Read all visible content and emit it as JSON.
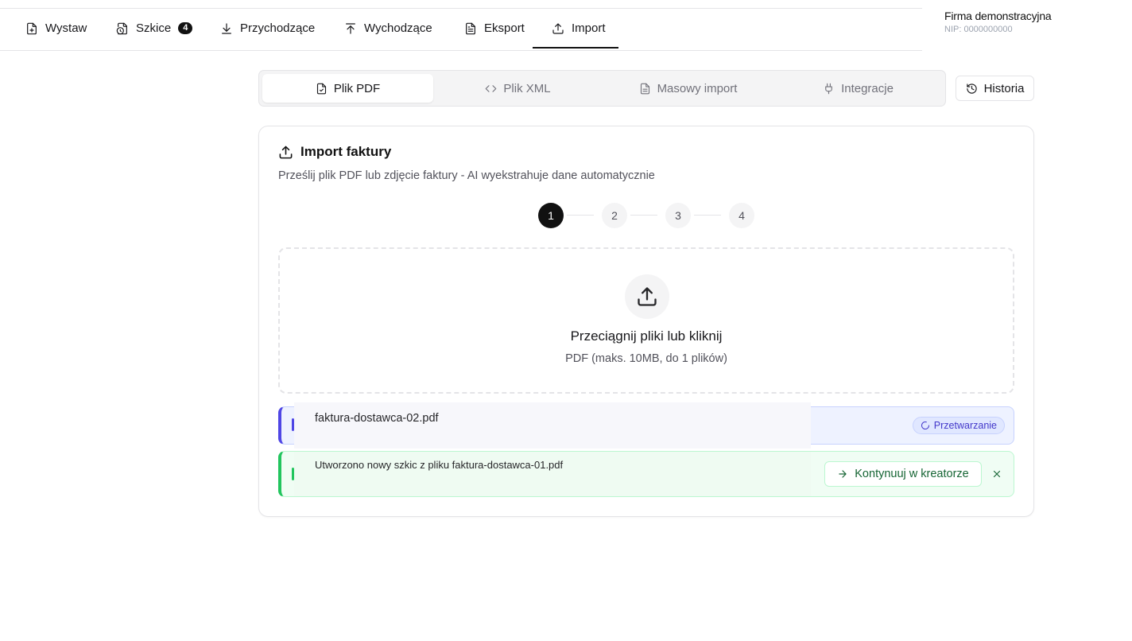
{
  "nav": {
    "items": [
      {
        "label": "Wystaw",
        "icon": "file-plus-icon"
      },
      {
        "label": "Szkice",
        "icon": "drafts-icon",
        "badge": "4"
      },
      {
        "label": "Przychodzące",
        "icon": "download-icon"
      },
      {
        "label": "Wychodzące",
        "icon": "upload-icon"
      },
      {
        "label": "Eksport",
        "icon": "file-text-icon"
      },
      {
        "label": "Import",
        "icon": "import-icon",
        "active": true
      }
    ]
  },
  "company": {
    "name": "Firma demonstracyjna",
    "nip": "NIP: 0000000000"
  },
  "tabs": [
    {
      "label": "Plik PDF",
      "icon": "file-pdf-icon",
      "active": true
    },
    {
      "label": "Plik XML",
      "icon": "code-icon"
    },
    {
      "label": "Masowy import",
      "icon": "file-stack-icon"
    },
    {
      "label": "Integracje",
      "icon": "plug-icon"
    }
  ],
  "history_label": "Historia",
  "card": {
    "title": "Import faktury",
    "description": "Prześlij plik PDF lub zdjęcie faktury - AI wyekstrahuje dane automatycznie"
  },
  "steps": [
    "1",
    "2",
    "3",
    "4"
  ],
  "active_step": 1,
  "dropzone": {
    "title": "Przeciągnij pliki lub kliknij",
    "subtitle": "PDF (maks. 10MB, do 1 plików)"
  },
  "files": {
    "processing": {
      "name": "faktura-dostawca-02.pdf",
      "status": "Przetwarzanie"
    },
    "done": {
      "message": "Utworzono nowy szkic z pliku faktura-dostawca-01.pdf",
      "continue_label": "Kontynuuj w kreatorze"
    }
  },
  "colors": {
    "processing_accent": "#4f46e5",
    "success_accent": "#22c55e",
    "text_primary": "#18181b"
  }
}
